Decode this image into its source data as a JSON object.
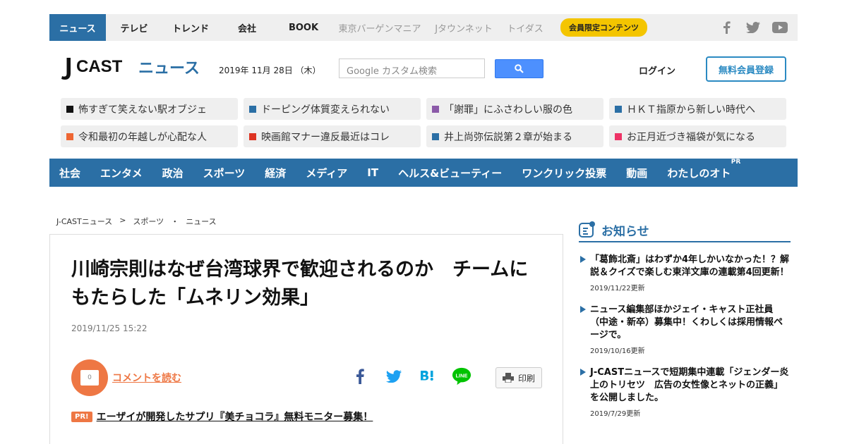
{
  "topnav": {
    "tabs": [
      {
        "label": "ニュース",
        "active": true
      },
      {
        "label": "テレビ"
      },
      {
        "label": "トレンド"
      },
      {
        "label": "会社"
      },
      {
        "label": "BOOK"
      }
    ],
    "sub_tabs": [
      "東京バーゲンマニア",
      "Jタウンネット",
      "トイダス"
    ],
    "member_badge": "会員限定コンテンツ",
    "social_icons": [
      "facebook-icon",
      "twitter-icon",
      "youtube-icon"
    ]
  },
  "header": {
    "logo_text": "J-CAST ニュース",
    "date": "2019年 11月 28日 （木）",
    "search_placeholder": "Google カスタム検索",
    "login_label": "ログイン",
    "register_label": "無料会員登録"
  },
  "topics": [
    {
      "label": "怖すぎて笑えない駅オブジェ",
      "color": "#111111"
    },
    {
      "label": "ドーピング体質変えられない",
      "color": "#2b6fa5"
    },
    {
      "label": "「謝罪」にふさわしい服の色",
      "color": "#8b5aa8"
    },
    {
      "label": "ＨＫＴ指原から新しい時代へ",
      "color": "#2b6fa5"
    },
    {
      "label": "令和最初の年越しが心配な人",
      "color": "#ee6633"
    },
    {
      "label": "映画館マナー違反最近はコレ",
      "color": "#dd3322"
    },
    {
      "label": "井上尚弥伝説第２章が始まる",
      "color": "#2b6fa5"
    },
    {
      "label": "お正月近づき福袋が気になる",
      "color": "#ee3366"
    }
  ],
  "categories": [
    "社会",
    "エンタメ",
    "政治",
    "スポーツ",
    "経済",
    "メディア",
    "IT",
    "ヘルス&ビューティー",
    "ワンクリック投票",
    "動画",
    "わたしのオト"
  ],
  "categories_pr": "PR",
  "breadcrumb": [
    "J-CASTニュース",
    ">",
    "スポーツ",
    "・",
    "ニュース"
  ],
  "article": {
    "headline": "川崎宗則はなぜ台湾球界で歓迎されるのか　チームにもたらした「ムネリン効果」",
    "date": "2019/11/25 15:22",
    "comment_count": "0",
    "comment_label": "コメントを読む",
    "print_label": "印刷",
    "pr_tag": "PR!",
    "pr_text": "エーザイが開発したサプリ『美チョコラ』無料モニター募集！"
  },
  "sidebar": {
    "title": "お知らせ",
    "notices": [
      {
        "text": "「葛飾北斎」はわずか4年しかいなかった！？解説＆クイズで楽しむ東洋文庫の連載第4回更新！",
        "date": "2019/11/22更新"
      },
      {
        "text": "ニュース編集部ほかジェイ・キャスト正社員（中途・新卒）募集中！くわしくは採用情報ページで。",
        "date": "2019/10/16更新"
      },
      {
        "text": "J-CASTニュースで短期集中連載「ジェンダー炎上のトリセツ　広告の女性像とネットの正義」を公開しました。",
        "date": "2019/7/29更新"
      }
    ]
  }
}
